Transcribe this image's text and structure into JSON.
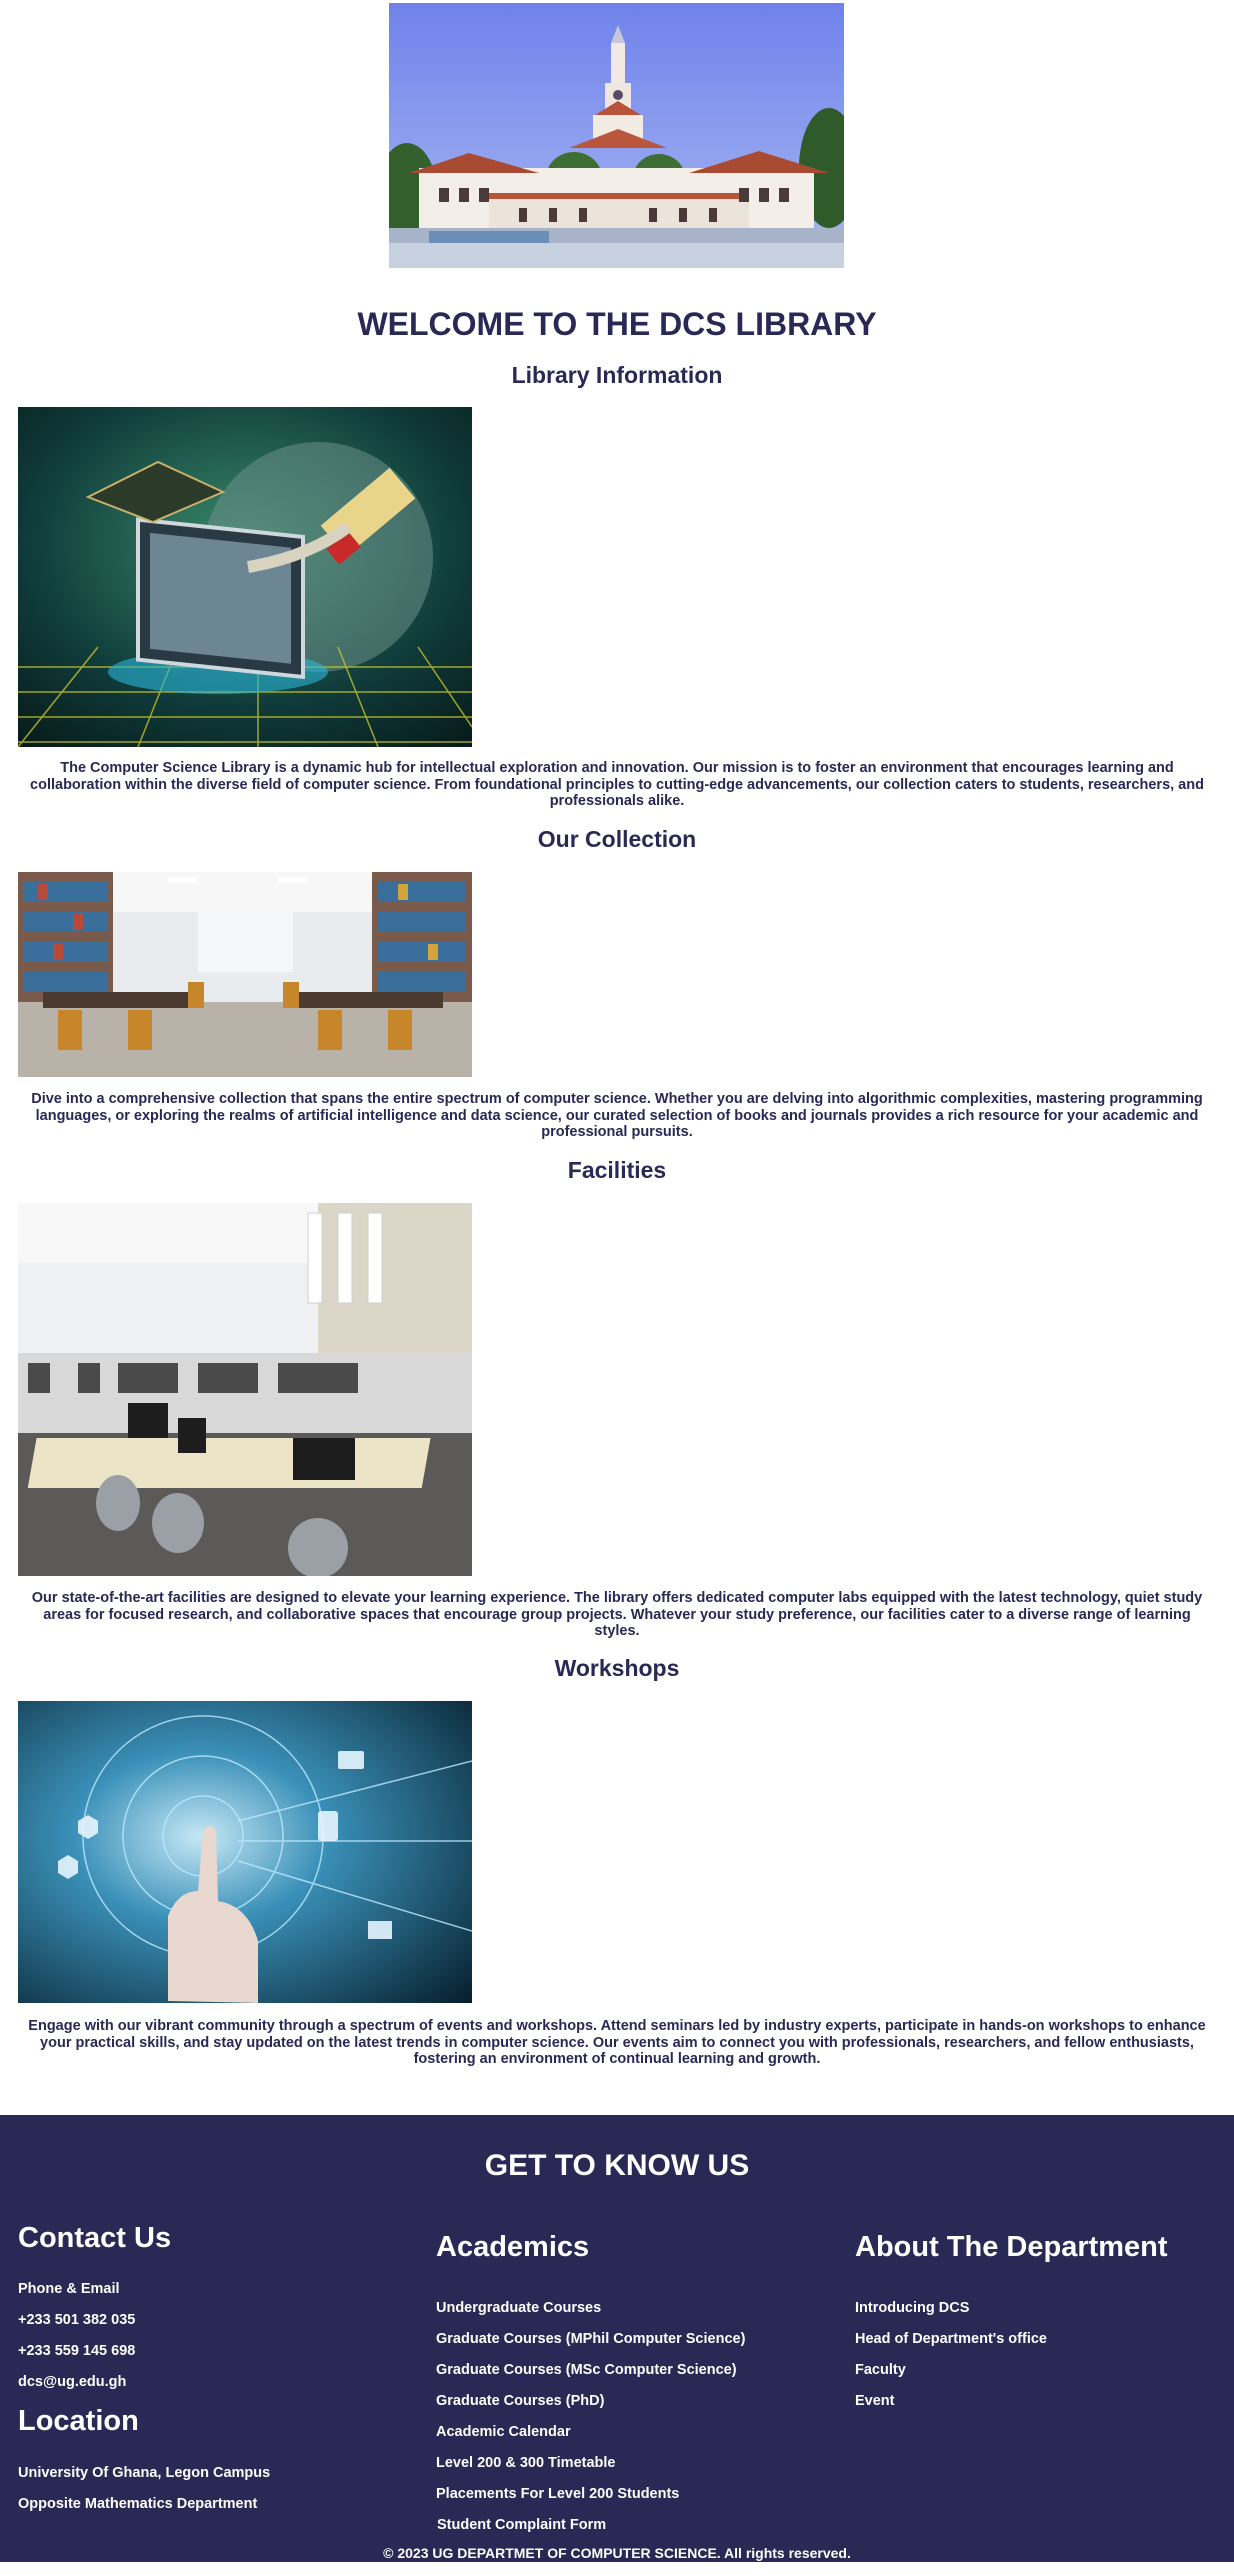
{
  "page": {
    "welcome_title": "WELCOME TO THE DCS LIBRARY"
  },
  "sections": [
    {
      "heading": "Library Information",
      "text": "The Computer Science Library is a dynamic hub for intellectual exploration and innovation. Our mission is to foster an environment that encourages learning and collaboration within the diverse field of computer science. From foundational principles to cutting-edge advancements, our collection caters to students, researchers, and professionals alike."
    },
    {
      "heading": "Our Collection",
      "text": "Dive into a comprehensive collection that spans the entire spectrum of computer science. Whether you are delving into algorithmic complexities, mastering programming languages, or exploring the realms of artificial intelligence and data science, our curated selection of books and journals provides a rich resource for your academic and professional pursuits."
    },
    {
      "heading": "Facilities",
      "text": "Our state-of-the-art facilities are designed to elevate your learning experience. The library offers dedicated computer labs equipped with the latest technology, quiet study areas for focused research, and collaborative spaces that encourage group projects. Whatever your study preference, our facilities cater to a diverse range of learning styles."
    },
    {
      "heading": "Workshops",
      "text": "Engage with our vibrant community through a spectrum of events and workshops. Attend seminars led by industry experts, participate in hands-on workshops to enhance your practical skills, and stay updated on the latest trends in computer science. Our events aim to connect you with professionals, researchers, and fellow enthusiasts, fostering an environment of continual learning and growth."
    }
  ],
  "footer": {
    "heading": "GET TO KNOW US",
    "contact": {
      "heading": "Contact Us",
      "items": [
        "Phone & Email",
        "+233 501 382 035",
        "+233 559 145 698",
        "dcs@ug.edu.gh"
      ]
    },
    "location": {
      "heading": "Location",
      "items": [
        "University Of Ghana, Legon Campus",
        "Opposite Mathematics Department"
      ]
    },
    "academics": {
      "heading": "Academics",
      "items": [
        "Undergraduate Courses",
        "Graduate Courses (MPhil Computer Science)",
        "Graduate Courses (MSc Computer Science)",
        "Graduate Courses (PhD)",
        "Academic Calendar",
        "Level 200 & 300 Timetable",
        "Placements For Level 200 Students",
        "Student Complaint Form"
      ]
    },
    "department": {
      "heading": "About The Department",
      "items": [
        "Introducing DCS",
        "Head of Department's office",
        "Faculty",
        "Event"
      ]
    },
    "copyright": "© 2023 UG DEPARTMET OF COMPUTER SCIENCE. All rights reserved."
  }
}
